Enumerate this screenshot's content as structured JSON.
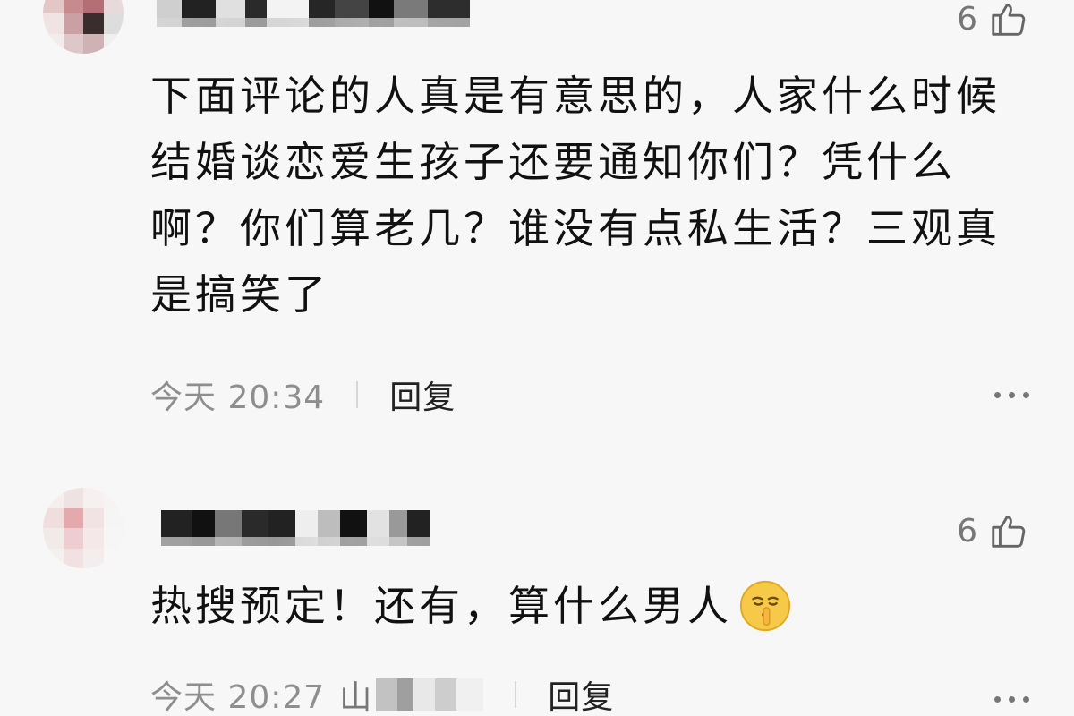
{
  "comments": [
    {
      "likes": "6",
      "text": "下面评论的人真是有意思的，人家什么时候结婚谈恋爱生孩子还要通知你们？凭什么啊？你们算老几？谁没有点私生活？三观真是搞笑了",
      "time": "今天 20:34",
      "reply_label": "回复",
      "location": ""
    },
    {
      "likes": "6",
      "text": "热搜预定！还有，算什么男人",
      "time": "今天 20:27",
      "reply_label": "回复",
      "location": "山"
    }
  ],
  "icons": {
    "like": "thumbs-up-icon",
    "more": "more-dots-icon",
    "emoji": "shush-face-emoji"
  },
  "colors": {
    "background": "#f7f7f7",
    "text": "#111111",
    "meta": "#8e8e8e",
    "emoji_yellow": "#f7c948"
  }
}
